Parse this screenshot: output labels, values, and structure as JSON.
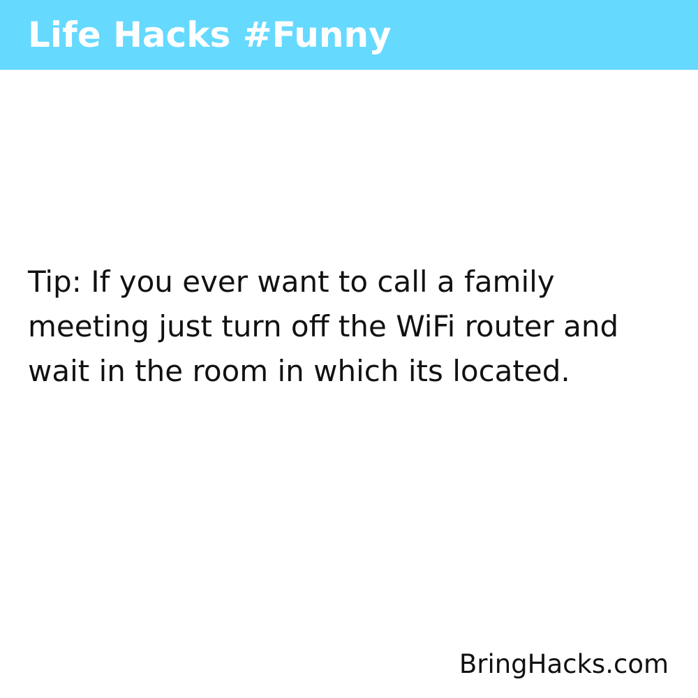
{
  "header": {
    "title": "Life Hacks #Funny",
    "background_color": "#66d9ff"
  },
  "content": {
    "tip": "Tip: If you ever want to call a family meeting just turn off the WiFi router and wait in the room in which its located."
  },
  "footer": {
    "site": "BringHacks.com"
  },
  "colors": {
    "page_background": "#ffffff",
    "text": "#111111",
    "header_text": "#ffffff"
  }
}
